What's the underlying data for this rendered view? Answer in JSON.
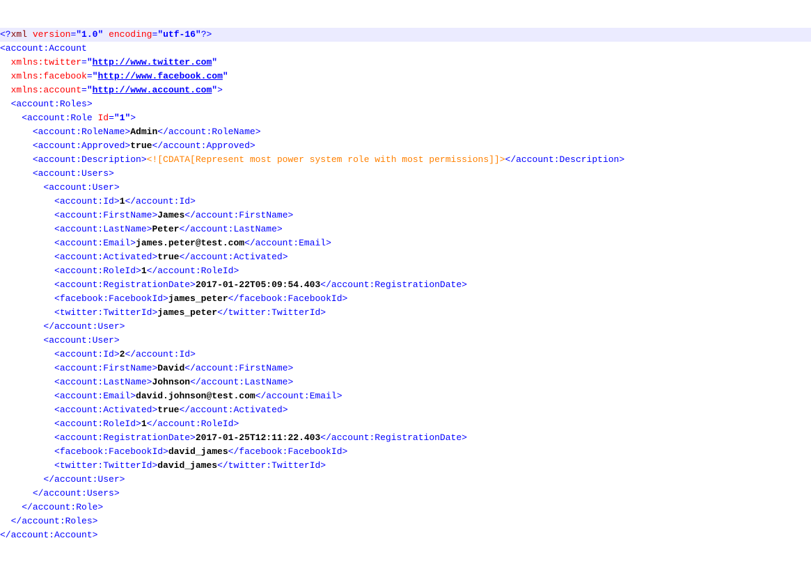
{
  "pi": {
    "target": "xml",
    "attrs": [
      {
        "n": "version",
        "v": "1.0"
      },
      {
        "n": "encoding",
        "v": "utf-16"
      }
    ]
  },
  "root": "account:Account",
  "ns": [
    {
      "prefix": "xmlns:twitter",
      "url": "http://www.twitter.com"
    },
    {
      "prefix": "xmlns:facebook",
      "url": "http://www.facebook.com"
    },
    {
      "prefix": "xmlns:account",
      "url": "http://www.account.com"
    }
  ],
  "rolesTag": "account:Roles",
  "roleTag": "account:Role",
  "roleIdAttr": {
    "n": "Id",
    "v": "1"
  },
  "roleName": {
    "tag": "account:RoleName",
    "v": "Admin"
  },
  "approved": {
    "tag": "account:Approved",
    "v": "true"
  },
  "description": {
    "tag": "account:Description",
    "cdata": "<![CDATA[Represent most power system role with most permissions]]>"
  },
  "usersTag": "account:Users",
  "userTag": "account:User",
  "users": [
    {
      "Id": {
        "tag": "account:Id",
        "v": "1"
      },
      "FirstName": {
        "tag": "account:FirstName",
        "v": "James"
      },
      "LastName": {
        "tag": "account:LastName",
        "v": "Peter"
      },
      "Email": {
        "tag": "account:Email",
        "v": "james.peter@test.com"
      },
      "Activated": {
        "tag": "account:Activated",
        "v": "true"
      },
      "RoleId": {
        "tag": "account:RoleId",
        "v": "1"
      },
      "RegistrationDate": {
        "tag": "account:RegistrationDate",
        "v": "2017-01-22T05:09:54.403"
      },
      "FacebookId": {
        "tag": "facebook:FacebookId",
        "v": "james_peter"
      },
      "TwitterId": {
        "tag": "twitter:TwitterId",
        "v": "james_peter"
      }
    },
    {
      "Id": {
        "tag": "account:Id",
        "v": "2"
      },
      "FirstName": {
        "tag": "account:FirstName",
        "v": "David"
      },
      "LastName": {
        "tag": "account:LastName",
        "v": "Johnson"
      },
      "Email": {
        "tag": "account:Email",
        "v": "david.johnson@test.com"
      },
      "Activated": {
        "tag": "account:Activated",
        "v": "true"
      },
      "RoleId": {
        "tag": "account:RoleId",
        "v": "1"
      },
      "RegistrationDate": {
        "tag": "account:RegistrationDate",
        "v": "2017-01-25T12:11:22.403"
      },
      "FacebookId": {
        "tag": "facebook:FacebookId",
        "v": "david_james"
      },
      "TwitterId": {
        "tag": "twitter:TwitterId",
        "v": "david_james"
      }
    }
  ]
}
